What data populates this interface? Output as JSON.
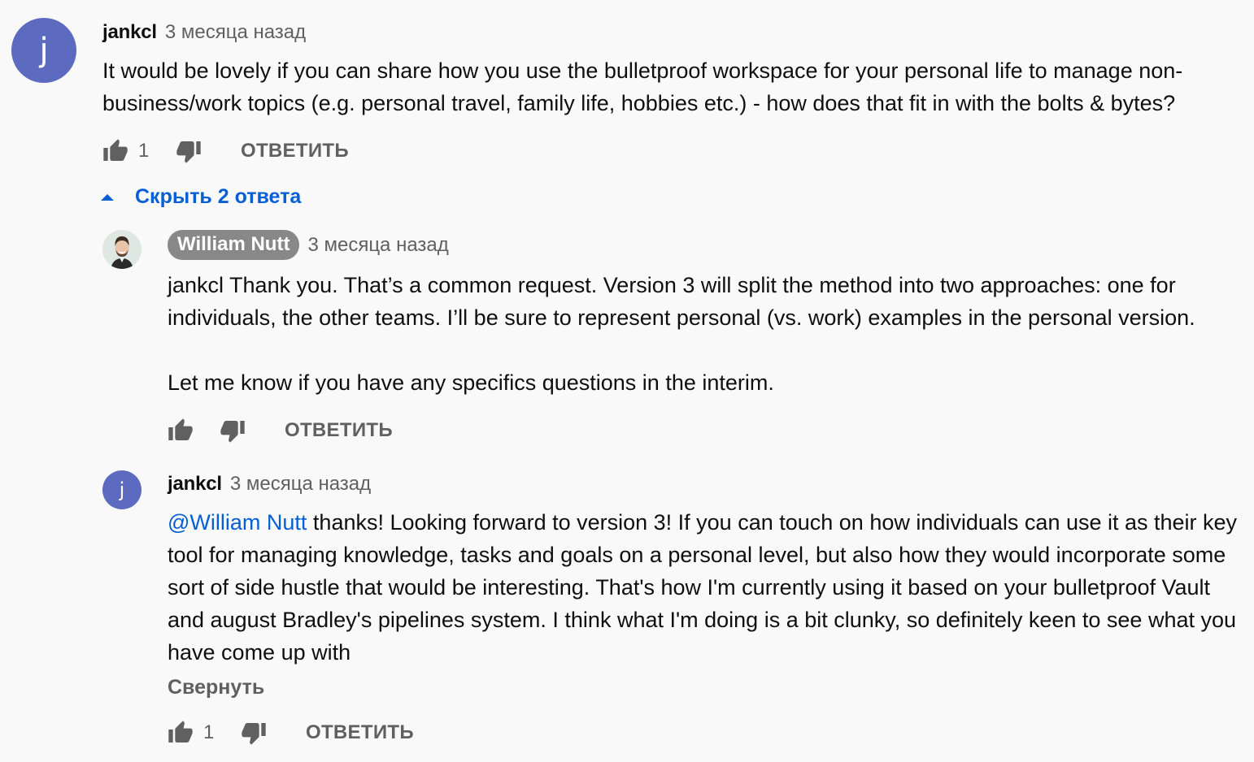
{
  "comments": {
    "top": {
      "avatar_letter": "j",
      "author": "jankcl",
      "time": "3 месяца назад",
      "text": "It would be lovely if you can share how you use the bulletproof workspace for your personal life to manage non-business/work topics (e.g. personal travel, family life, hobbies etc.) - how does that fit in with the bolts & bytes?",
      "likes": "1",
      "reply_label": "ОТВЕТИТЬ"
    },
    "toggle_replies_label": "Скрыть 2 ответа",
    "replies": [
      {
        "author": "William Nutt",
        "time": "3 месяца назад",
        "paragraphs": [
          "jankcl Thank you. That’s a common request. Version 3 will split the method into two approaches: one for individuals, the other teams. I’ll be sure to represent personal (vs. work) examples in the personal version.",
          "Let me know if you have any specifics questions in the interim."
        ],
        "likes": "",
        "reply_label": "ОТВЕТИТЬ"
      },
      {
        "avatar_letter": "j",
        "author": "jankcl",
        "time": "3 месяца назад",
        "mention": "@William Nutt",
        "text": " thanks! Looking forward to version 3! If you can touch on how individuals can use it as their key tool for managing knowledge, tasks and goals on a personal level, but also how they would incorporate some sort of side hustle that would be interesting. That's how I'm currently using it based on your bulletproof Vault and august Bradley's pipelines system. I think what I'm doing is a bit clunky, so definitely keen to see what you have come up with",
        "collapse_label": "Свернуть",
        "likes": "1",
        "reply_label": "ОТВЕТИТЬ"
      }
    ]
  },
  "icons": {
    "like": "thumbs-up-icon",
    "dislike": "thumbs-down-icon",
    "caret": "caret-up-icon"
  },
  "colors": {
    "link": "#065fd4",
    "secondary": "#606060",
    "avatar": "#5c6bc0",
    "badge": "#888888"
  }
}
